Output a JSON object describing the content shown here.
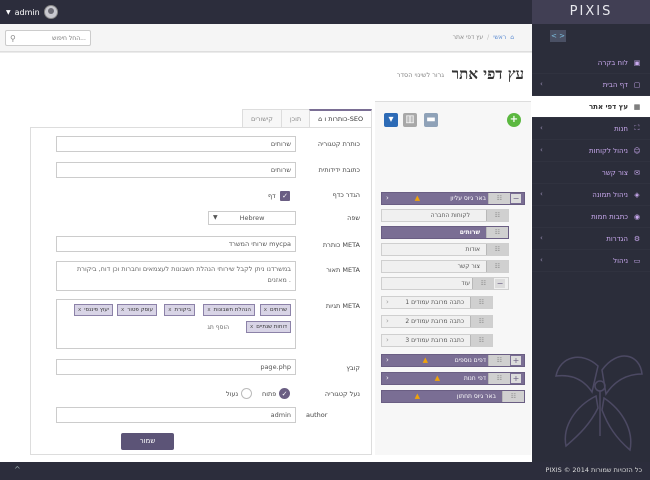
{
  "topbar": {
    "user": "admin",
    "brand": "PIXIS"
  },
  "search": {
    "placeholder": "החל חיפוש..."
  },
  "breadcrumb": {
    "home": "ראשי",
    "separator": "/",
    "current": "עץ דפי אתר"
  },
  "page": {
    "title": "עץ דפי אתר",
    "subtitle": "גרור לשינוי הסדר"
  },
  "sidebar": {
    "toggle": "< >",
    "items": [
      {
        "label": "לוח בקרה",
        "icon": "dashboard-icon",
        "glyph": "▣",
        "chevron": ""
      },
      {
        "label": "דף הבית",
        "icon": "home-page-icon",
        "glyph": "▢",
        "chevron": "‹"
      },
      {
        "label": "עץ דפי אתר",
        "icon": "sitemap-icon",
        "glyph": "▦",
        "chevron": ""
      },
      {
        "label": "חנות",
        "icon": "shop-icon",
        "glyph": "⛶",
        "chevron": "‹"
      },
      {
        "label": "ניהול לקוחות",
        "icon": "users-icon",
        "glyph": "☺",
        "chevron": "‹"
      },
      {
        "label": "צור קשר",
        "icon": "envelope-icon",
        "glyph": "✉",
        "chevron": ""
      },
      {
        "label": "ניהול תמונה",
        "icon": "image-icon",
        "glyph": "◈",
        "chevron": "‹"
      },
      {
        "label": "כתבות חמות",
        "icon": "rss-icon",
        "glyph": "◉",
        "chevron": ""
      },
      {
        "label": "הגדרות",
        "icon": "settings-icon",
        "glyph": "⚙",
        "chevron": "‹"
      },
      {
        "label": "ניהול",
        "icon": "monitor-icon",
        "glyph": "▭",
        "chevron": "‹"
      }
    ]
  },
  "tree": {
    "nodes": [
      {
        "label": "באר גיוס עליון",
        "warn": true,
        "pm": "−"
      },
      {
        "label": "לקוחות החברה",
        "warn": false,
        "pm": ""
      },
      {
        "label": "שרותים",
        "warn": false,
        "pm": ""
      },
      {
        "label": "אודות",
        "warn": false,
        "pm": ""
      },
      {
        "label": "צור קשר",
        "warn": false,
        "pm": ""
      },
      {
        "label": "עוד",
        "warn": false,
        "pm": "−"
      },
      {
        "label": "כתבה מרובת עמודים 1",
        "warn": false,
        "pm": ""
      },
      {
        "label": "כתבה מרובת עמודים 2",
        "warn": false,
        "pm": ""
      },
      {
        "label": "כתבה מרובת עמודים 3",
        "warn": false,
        "pm": ""
      },
      {
        "label": "דפים נוספים",
        "warn": true,
        "pm": "+"
      },
      {
        "label": "דפי חנות",
        "warn": true,
        "pm": "+"
      },
      {
        "label": "באר גיוס תחתון",
        "warn": true,
        "pm": ""
      }
    ]
  },
  "tabs": [
    "כותרות ו-SEO",
    "תוכן",
    "קישורים"
  ],
  "form": {
    "category_title": {
      "label": "כותרת קטגוריה",
      "value": "שרותים"
    },
    "friendly_url": {
      "label": "כתובת ידידותית",
      "value": "שרותים"
    },
    "page_definition": {
      "label": "הגדר כדף",
      "option": "דף"
    },
    "language": {
      "label": "שפה",
      "value": "Hebrew"
    },
    "meta_title": {
      "label": "כותרת META",
      "value": "שרותי המשרד mycpa"
    },
    "meta_description": {
      "label": "תאור META",
      "value": "במשרדנו ניתן לקבל שירותי הנהלת חשבונות לעצמאים וחברות וכן דוח, ביקורת מאזנים ."
    },
    "meta_tags": {
      "label": "תגיות META",
      "tags": [
        "שרותים",
        "הנהלת חשבונות",
        "ביקורת",
        "עוסק פטור",
        "יעוץ פיננסי",
        "דוחות שנתיים"
      ],
      "add_label": "הוסף תג",
      "remove": "x"
    },
    "file": {
      "label": "קובץ",
      "value": "page.php"
    },
    "lock_category": {
      "label": "נעל קטגוריה",
      "open": "פתוח",
      "locked": "נעול"
    },
    "author": {
      "label": "author",
      "value": "admin"
    },
    "save": "שמור"
  },
  "footer": {
    "copyright": "PIXIS © 2014 כל הזכויות שמורות",
    "up": "^"
  },
  "colors": {
    "accent": "#7a6e94",
    "topbar": "#2c2d3c",
    "sidebar": "#2b2d3a",
    "sidebar_text": "#c9a9ef",
    "add": "#5bb840"
  }
}
